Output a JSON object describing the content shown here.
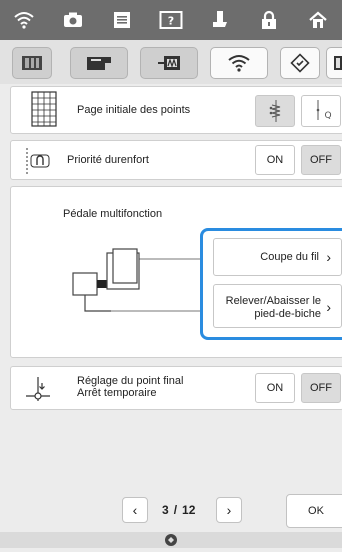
{
  "top_icons": [
    "wifi-icon",
    "camera-icon",
    "document-icon",
    "help-icon",
    "sewing-foot-icon",
    "lock-icon",
    "home-icon"
  ],
  "category_tabs": [
    "settings-tab-general",
    "settings-tab-sewing",
    "settings-tab-embroidery",
    "settings-tab-wireless",
    "settings-tab-info",
    "settings-tab-more"
  ],
  "rows": {
    "start_point": {
      "label": "Page initiale des points"
    },
    "priority": {
      "label": "Priorité durenfort",
      "on": "ON",
      "off": "OFF"
    },
    "pedal": {
      "label": "Pédale multifonction",
      "btn1": "Coupe du fil",
      "btn2": "Relever/Abaisser le pied-de-biche"
    },
    "endpoint": {
      "label_line1": "Réglage du point final",
      "label_line2": "Arrêt temporaire",
      "on": "ON",
      "off": "OFF"
    }
  },
  "pager": {
    "current": "3",
    "separator": "/",
    "total": "12"
  },
  "ok_label": "OK",
  "colors": {
    "accent": "#2a8ce0",
    "topbar": "#6d6d6d",
    "background": "#ececec"
  }
}
